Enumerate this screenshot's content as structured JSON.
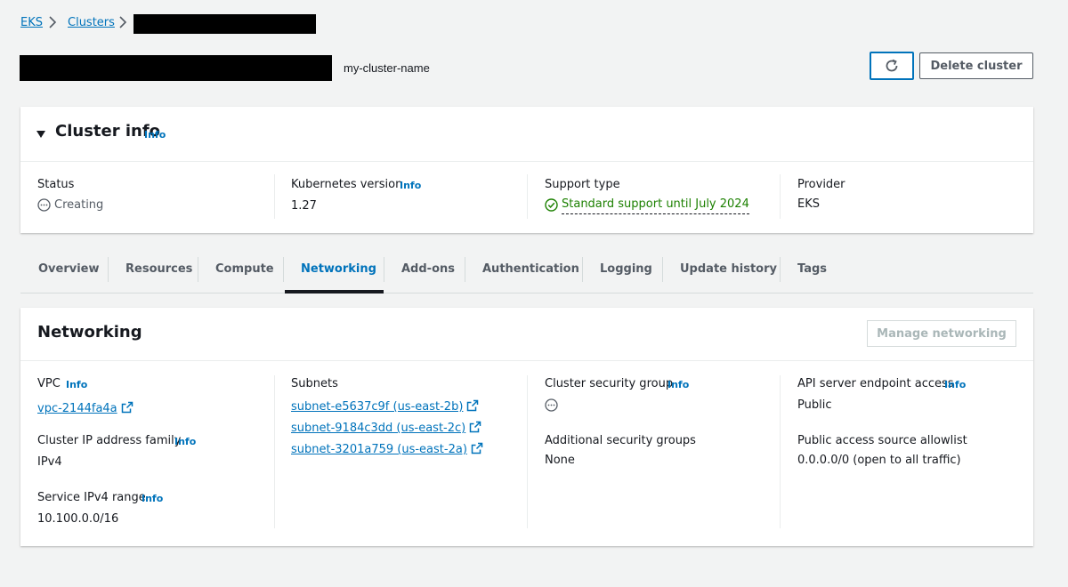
{
  "breadcrumb": {
    "eks": "EKS",
    "clusters": "Clusters"
  },
  "header": {
    "subtitle": "my-cluster-name",
    "delete_label": "Delete cluster"
  },
  "cluster_info": {
    "title": "Cluster info",
    "info": "Info",
    "status_label": "Status",
    "status_value": "Creating",
    "k8s_label": "Kubernetes version",
    "k8s_value": "1.27",
    "support_label": "Support type",
    "support_value": "Standard support until July 2024",
    "provider_label": "Provider",
    "provider_value": "EKS"
  },
  "tabs": [
    "Overview",
    "Resources",
    "Compute",
    "Networking",
    "Add-ons",
    "Authentication",
    "Logging",
    "Update history",
    "Tags"
  ],
  "networking": {
    "title": "Networking",
    "manage_label": "Manage networking",
    "vpc_label": "VPC",
    "vpc_value": "vpc-2144fa4a",
    "ip_family_label": "Cluster IP address family",
    "ip_family_value": "IPv4",
    "svc_range_label": "Service IPv4 range",
    "svc_range_value": "10.100.0.0/16",
    "subnets_label": "Subnets",
    "subnets": [
      "subnet-e5637c9f (us-east-2b)",
      "subnet-9184c3dd (us-east-2c)",
      "subnet-3201a759 (us-east-2a)"
    ],
    "csg_label": "Cluster security group",
    "asg_label": "Additional security groups",
    "asg_value": "None",
    "api_label": "API server endpoint access",
    "api_value": "Public",
    "allow_label": "Public access source allowlist",
    "allow_value": "0.0.0.0/0 (open to all traffic)"
  }
}
